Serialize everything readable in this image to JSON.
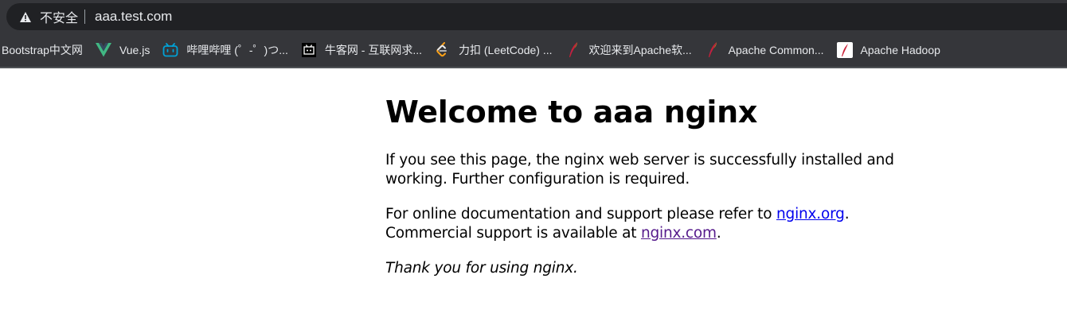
{
  "browser": {
    "address_bar": {
      "security_label": "不安全",
      "url": "aaa.test.com"
    },
    "bookmarks": [
      {
        "label": "Bootstrap中文网",
        "icon": "bootstrap-icon"
      },
      {
        "label": "Vue.js",
        "icon": "vue-icon"
      },
      {
        "label": "哔哩哔哩 (゜-゜)つ...",
        "icon": "bilibili-icon"
      },
      {
        "label": "牛客网 - 互联网求...",
        "icon": "nowcoder-icon"
      },
      {
        "label": "力扣 (LeetCode) ...",
        "icon": "leetcode-icon"
      },
      {
        "label": "欢迎来到Apache软...",
        "icon": "apache-feather-icon"
      },
      {
        "label": "Apache Common...",
        "icon": "apache-feather-icon"
      },
      {
        "label": "Apache Hadoop",
        "icon": "hadoop-icon"
      }
    ]
  },
  "page": {
    "heading": "Welcome to aaa nginx",
    "para1": "If you see this page, the nginx web server is successfully installed and working. Further configuration is required.",
    "para2_prefix": "For online documentation and support please refer to ",
    "link_org": "nginx.org",
    "para2_mid": ".",
    "para2_line2": "Commercial support is available at ",
    "link_com": "nginx.com",
    "para2_end": ".",
    "thanks": "Thank you for using nginx."
  },
  "colors": {
    "chrome_bg": "#35363a",
    "omnibox_bg": "#202124",
    "link_unvisited": "#0000ee",
    "link_visited": "#551a8b"
  }
}
